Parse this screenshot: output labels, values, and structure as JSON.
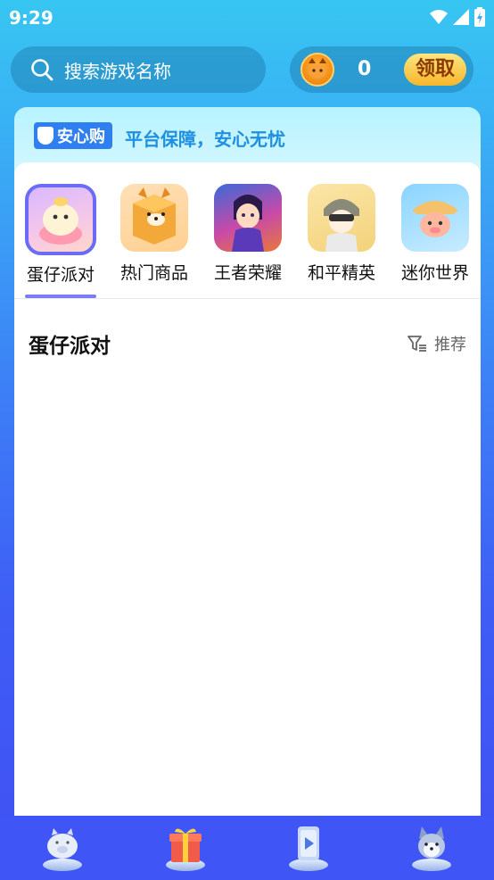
{
  "status_bar": {
    "time": "9:29"
  },
  "search": {
    "placeholder": "搜索游戏名称"
  },
  "coins": {
    "count": "0",
    "claim_label": "领取"
  },
  "banner": {
    "badge_text": "安心购",
    "slogan": "平台保障，安心无忧"
  },
  "game_tabs": [
    {
      "label": "蛋仔派对",
      "active": true
    },
    {
      "label": "热门商品",
      "active": false
    },
    {
      "label": "王者荣耀",
      "active": false
    },
    {
      "label": "和平精英",
      "active": false
    },
    {
      "label": "迷你世界",
      "active": false
    }
  ],
  "section": {
    "title": "蛋仔派对",
    "sort_label": "推荐"
  },
  "colors": {
    "accent": "#6b6cf5",
    "nav_bg": "#3f55f5",
    "claim_gold": "#f8b62a"
  }
}
